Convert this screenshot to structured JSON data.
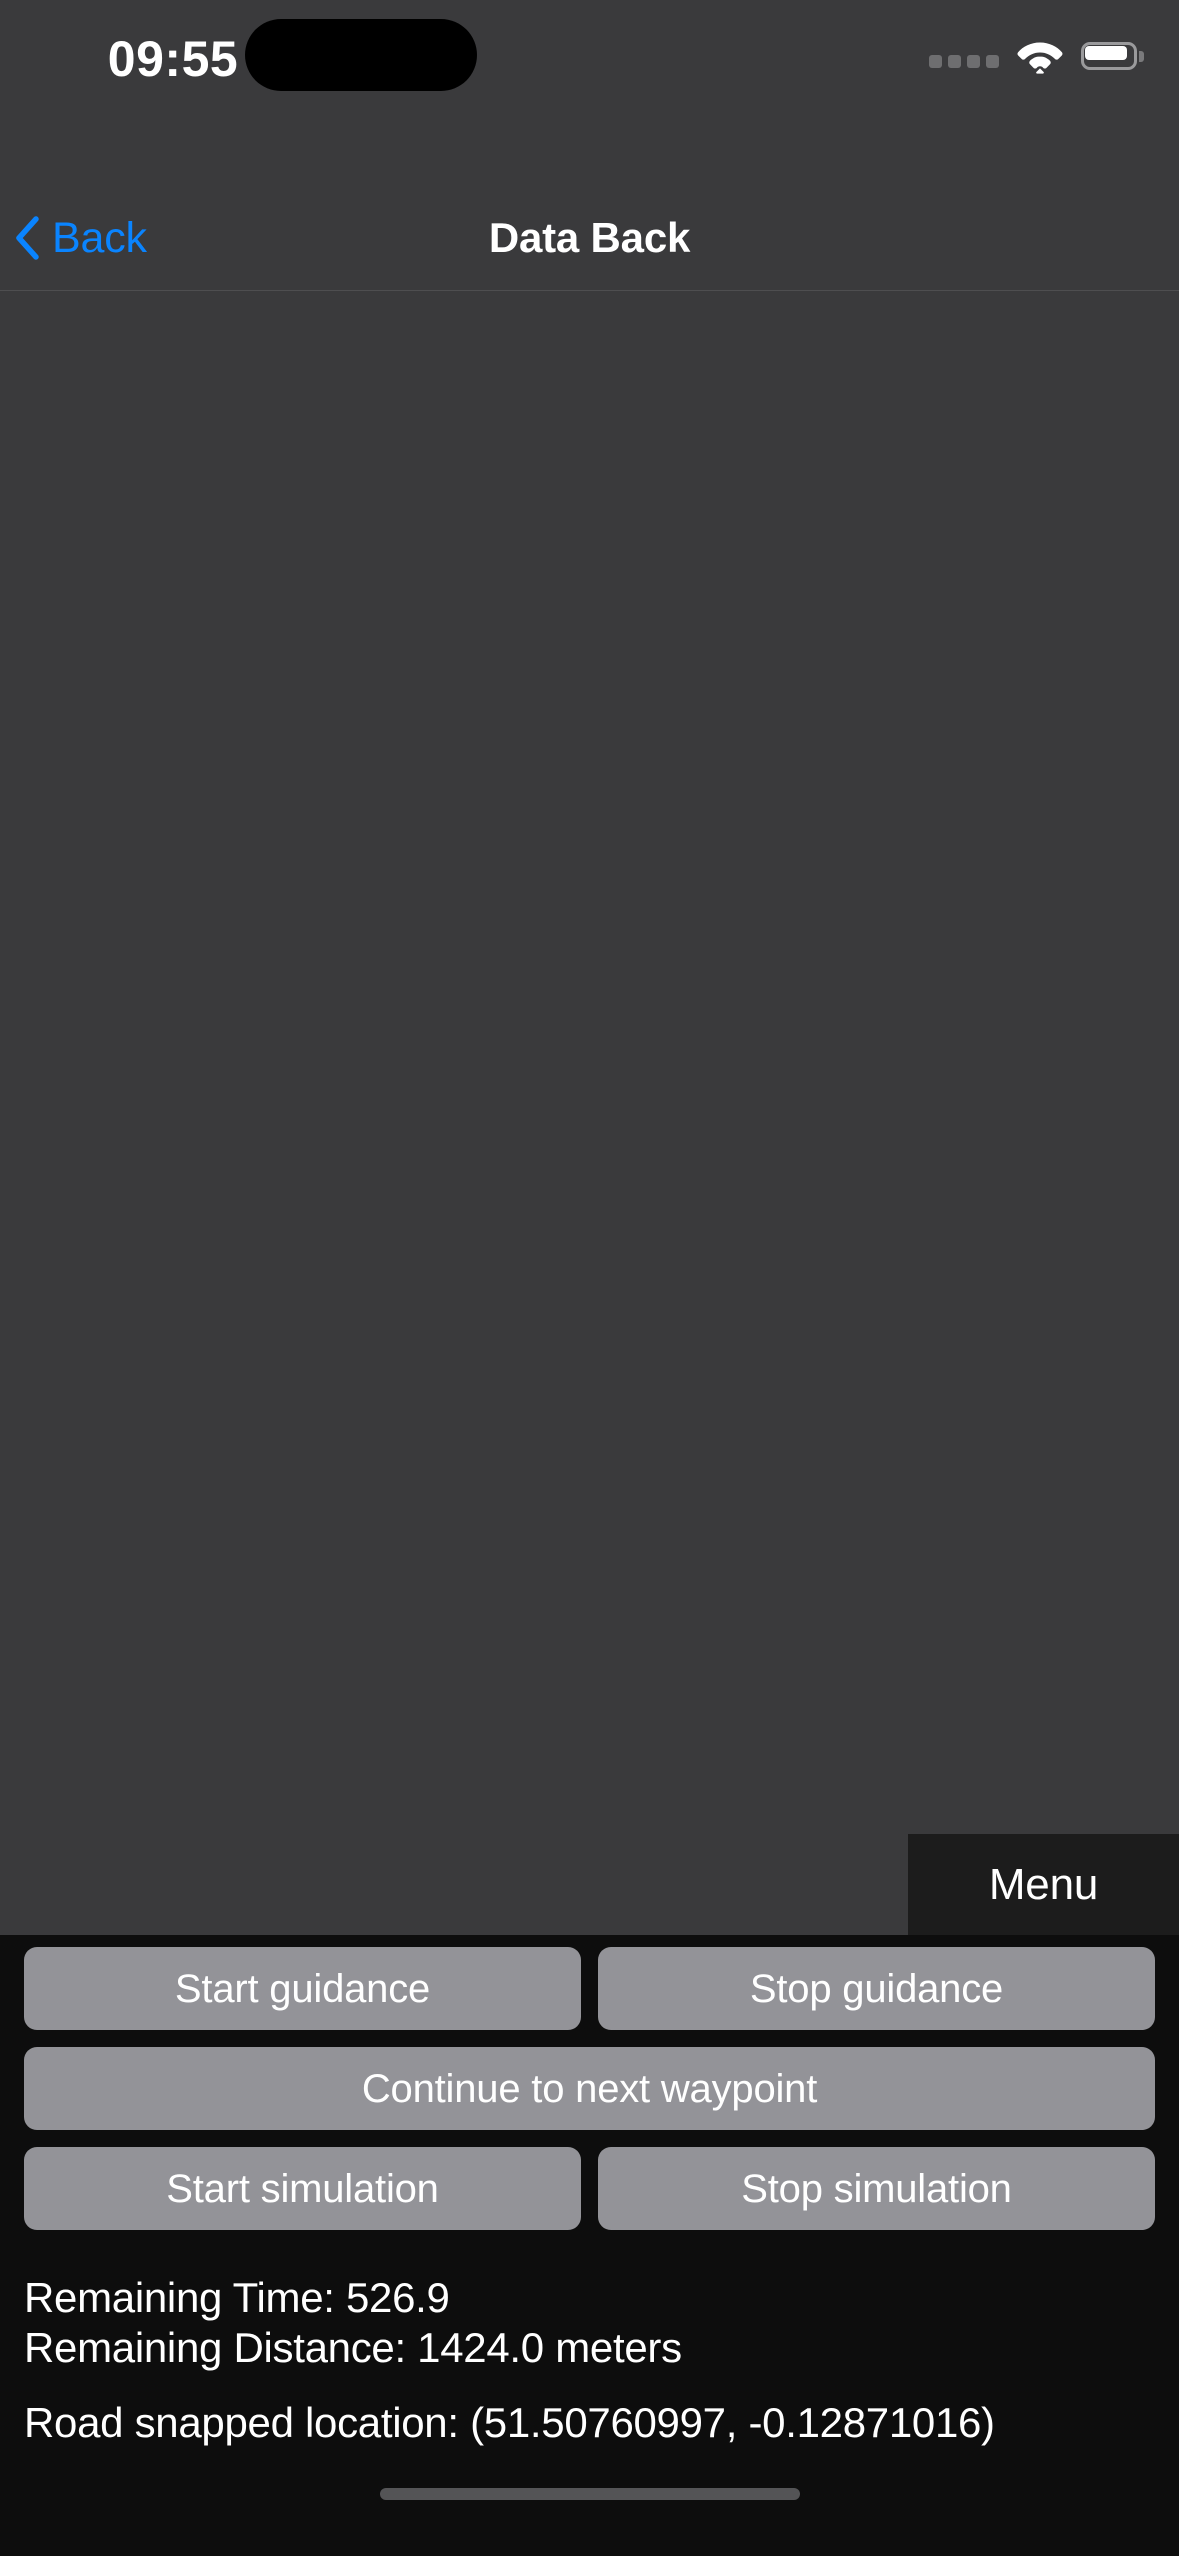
{
  "status_bar": {
    "time": "09:55",
    "icons": {
      "signal": "signal-dots-icon",
      "wifi": "wifi-icon",
      "battery": "battery-icon"
    }
  },
  "nav_bar": {
    "back_label": "Back",
    "back_icon": "chevron-left-icon",
    "title": "Data Back"
  },
  "map": {
    "menu_label": "Menu"
  },
  "controls": {
    "row1": [
      {
        "label": "Start guidance",
        "name": "start-guidance-button"
      },
      {
        "label": "Stop guidance",
        "name": "stop-guidance-button"
      }
    ],
    "row2": [
      {
        "label": "Continue to next waypoint",
        "name": "continue-next-waypoint-button"
      }
    ],
    "row3": [
      {
        "label": "Start simulation",
        "name": "start-simulation-button"
      },
      {
        "label": "Stop simulation",
        "name": "stop-simulation-button"
      }
    ]
  },
  "status_readout": {
    "remaining_time": "Remaining Time: 526.9",
    "remaining_distance": "Remaining Distance: 1424.0 meters",
    "road_snapped_location": "Road snapped location: (51.50760997, -0.12871016)"
  },
  "colors": {
    "accent_blue": "#0a84ff",
    "map_background": "#3a3a3c",
    "panel_background": "#0d0d0d",
    "button_gray": "#939398",
    "menu_background": "#1c1c1c"
  }
}
